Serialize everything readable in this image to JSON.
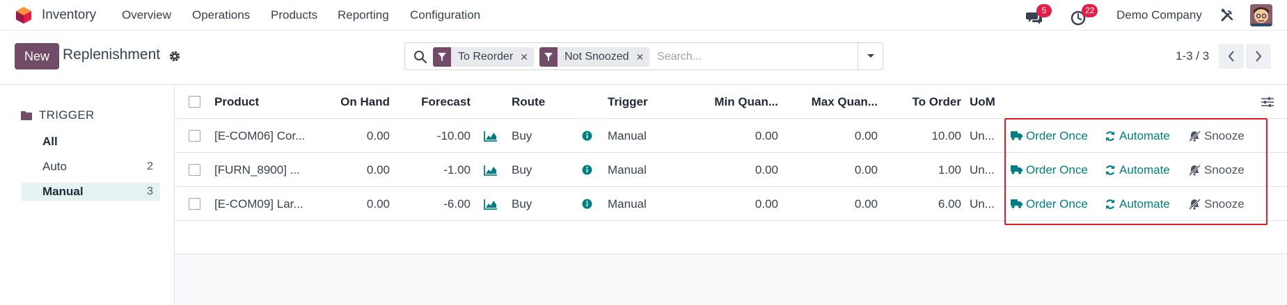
{
  "navbar": {
    "app_name": "Inventory",
    "menu": [
      "Overview",
      "Operations",
      "Products",
      "Reporting",
      "Configuration"
    ],
    "messages_badge": "5",
    "activities_badge": "22",
    "company": "Demo Company"
  },
  "control_panel": {
    "new_label": "New",
    "title": "Replenishment",
    "facets": [
      "To Reorder",
      "Not Snoozed"
    ],
    "search_placeholder": "Search...",
    "pager_value": "1-3 / 3"
  },
  "sidebar": {
    "header": "TRIGGER",
    "items": [
      {
        "label": "All",
        "count": "",
        "active": false
      },
      {
        "label": "Auto",
        "count": "2",
        "active": false
      },
      {
        "label": "Manual",
        "count": "3",
        "active": true
      }
    ]
  },
  "list": {
    "columns": {
      "product": "Product",
      "on_hand": "On Hand",
      "forecast": "Forecast",
      "route": "Route",
      "trigger": "Trigger",
      "min_qty": "Min Quan...",
      "max_qty": "Max Quan...",
      "to_order": "To Order",
      "uom": "UoM"
    },
    "rows": [
      {
        "product": "[E-COM06] Cor...",
        "on_hand": "0.00",
        "forecast": "-10.00",
        "route": "Buy",
        "trigger": "Manual",
        "min_qty": "0.00",
        "max_qty": "0.00",
        "to_order": "10.00",
        "uom": "Un...",
        "order_once": "Order Once",
        "automate": "Automate",
        "snooze": "Snooze"
      },
      {
        "product": "[FURN_8900] ...",
        "on_hand": "0.00",
        "forecast": "-1.00",
        "route": "Buy",
        "trigger": "Manual",
        "min_qty": "0.00",
        "max_qty": "0.00",
        "to_order": "1.00",
        "uom": "Un...",
        "order_once": "Order Once",
        "automate": "Automate",
        "snooze": "Snooze"
      },
      {
        "product": "[E-COM09] Lar...",
        "on_hand": "0.00",
        "forecast": "-6.00",
        "route": "Buy",
        "trigger": "Manual",
        "min_qty": "0.00",
        "max_qty": "0.00",
        "to_order": "6.00",
        "uom": "Un...",
        "order_once": "Order Once",
        "automate": "Automate",
        "snooze": "Snooze"
      }
    ]
  },
  "icons": {
    "app_logo": "odoo-inventory-logo-icon",
    "messages": "chat-bubbles-icon",
    "activities": "clock-icon",
    "debug": "tools-icon",
    "settings": "gear-icon",
    "search": "search-icon",
    "filter": "funnel-icon",
    "forecast_chart": "area-chart-icon",
    "route_info": "info-circle-icon",
    "order_once": "truck-icon",
    "automate": "refresh-icon",
    "snooze": "bell-slash-icon",
    "optional_columns": "sliders-icon"
  },
  "colors": {
    "brand": "#714b67",
    "accent_teal": "#017e84",
    "badge_red": "#e11d48",
    "highlight_red": "#e11b22"
  }
}
